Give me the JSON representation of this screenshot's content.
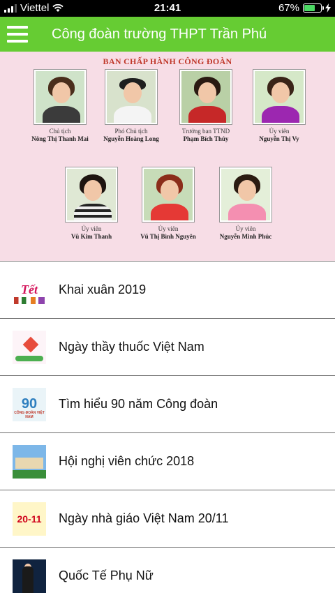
{
  "status_bar": {
    "carrier": "Viettel",
    "time": "21:41",
    "battery_percent": "67%",
    "battery_level": 0.67,
    "icons": [
      "signal-icon",
      "wifi-icon",
      "battery-icon",
      "charging-icon"
    ]
  },
  "header": {
    "title": "Công đoàn trường THPT Trần Phú",
    "menu_icon": "hamburger-menu-icon",
    "color": "#66cc33"
  },
  "banner": {
    "title": "BAN CHẤP HÀNH CÔNG ĐOÀN",
    "members": [
      {
        "role": "Chủ tịch",
        "name": "Nông Thị Thanh Mai"
      },
      {
        "role": "Phó Chủ tịch",
        "name": "Nguyễn Hoàng Long"
      },
      {
        "role": "Trưởng ban TTND",
        "name": "Phạm Bích Thủy"
      },
      {
        "role": "Ủy viên",
        "name": "Nguyễn Thị Vy"
      },
      {
        "role": "Ủy viên",
        "name": "Vũ Kim Thanh"
      },
      {
        "role": "Ủy viên",
        "name": "Vũ Thị Bình Nguyên"
      },
      {
        "role": "Ủy viên",
        "name": "Nguyễn Minh Phúc"
      }
    ]
  },
  "news": [
    {
      "title": "Khai xuân 2019",
      "thumb_text": "Tết"
    },
    {
      "title": "Ngày thầy thuốc Việt Nam",
      "thumb_text": ""
    },
    {
      "title": "Tìm hiểu 90 năm Công đoàn",
      "thumb_text": "90",
      "thumb_caption": "CÔNG ĐOÀN VIỆT NAM"
    },
    {
      "title": "Hội nghị viên chức 2018",
      "thumb_text": ""
    },
    {
      "title": "Ngày nhà giáo Việt Nam 20/11",
      "thumb_text": "20-11"
    },
    {
      "title": "Quốc Tế Phụ Nữ",
      "thumb_text": ""
    }
  ]
}
